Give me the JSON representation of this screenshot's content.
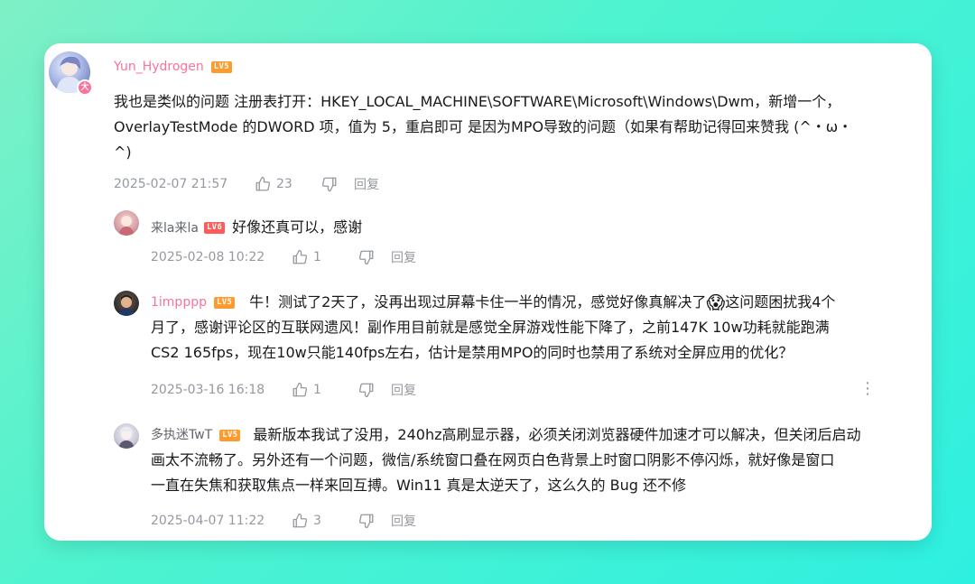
{
  "comments": [
    {
      "user": "Yun_Hydrogen",
      "level": "LV5",
      "badge": "大",
      "lines": [
        "我也是类似的问题 注册表打开：HKEY_LOCAL_MACHINE\\SOFTWARE\\Microsoft\\Windows\\Dwm，新增一个，",
        "OverlayTestMode 的DWORD 项，值为 5，重启即可 是因为MPO导致的问题（如果有帮助记得回来赞我 (^・ω・",
        "^)"
      ],
      "time": "2025-02-07 21:57",
      "likes": "23",
      "reply": "回复"
    }
  ],
  "replies": [
    {
      "user": "来la来la",
      "level": "LV6",
      "text": "好像还真可以，感谢",
      "time": "2025-02-08 10:22",
      "likes": "1",
      "reply": "回复"
    },
    {
      "user": "1impppp",
      "level": "LV5",
      "lines": [
        "牛！测试了2天了，没再出现过屏幕卡住一半的情况，感觉好像真解决了",
        "这问题困扰我4个",
        "月了，感谢评论区的互联网遗风！副作用目前就是感觉全屏游戏性能下降了，之前147K 10w功耗就能跑满",
        "CS2 165fps，现在10w只能140fps左右，估计是禁用MPO的同时也禁用了系统对全屏应用的优化？"
      ],
      "emoji": "😱",
      "time": "2025-03-16 16:18",
      "likes": "1",
      "reply": "回复",
      "more": "⋮"
    },
    {
      "user": "多执迷TwT",
      "level": "LV5",
      "lines": [
        "最新版本我试了没用，240hz高刷显示器，必须关闭浏览器硬件加速才可以解决，但关闭后启动",
        "画太不流畅了。另外还有一个问题，微信/系统窗口叠在网页白色背景上时窗口阴影不停闪烁，就好像是窗口",
        "一直在失焦和获取焦点一样来回互搏。Win11 真是太逆天了，这么久的 Bug 还不修"
      ],
      "time": "2025-04-07 11:22",
      "likes": "3",
      "reply": "回复"
    }
  ],
  "icons": {
    "like": "thumbs-up-icon",
    "dislike": "thumbs-down-icon",
    "more": "more-vertical-icon"
  },
  "colors": {
    "username_pink": "#fb7299",
    "meta_gray": "#9499a0",
    "text": "#18191c"
  }
}
